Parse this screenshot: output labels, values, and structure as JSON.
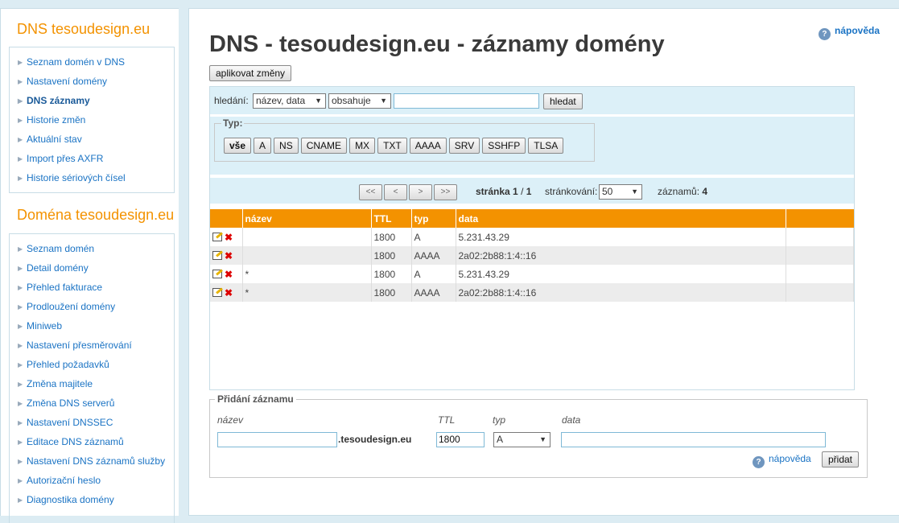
{
  "sidebar": {
    "dns_title": "DNS tesoudesign.eu",
    "dns_items": [
      {
        "label": "Seznam domén v DNS",
        "active": false
      },
      {
        "label": "Nastavení domény",
        "active": false
      },
      {
        "label": "DNS záznamy",
        "active": true
      },
      {
        "label": "Historie změn",
        "active": false
      },
      {
        "label": "Aktuální stav",
        "active": false
      },
      {
        "label": "Import přes AXFR",
        "active": false
      },
      {
        "label": "Historie sériových čísel",
        "active": false
      }
    ],
    "domain_title": "Doména tesoudesign.eu",
    "domain_items": [
      {
        "label": "Seznam domén"
      },
      {
        "label": "Detail domény"
      },
      {
        "label": "Přehled fakturace"
      },
      {
        "label": "Prodloužení domény"
      },
      {
        "label": "Miniweb"
      },
      {
        "label": "Nastavení přesměrování"
      },
      {
        "label": "Přehled požadavků"
      },
      {
        "label": "Změna majitele"
      },
      {
        "label": "Změna DNS serverů"
      },
      {
        "label": "Nastavení DNSSEC"
      },
      {
        "label": "Editace DNS záznamů"
      },
      {
        "label": "Nastavení DNS záznamů služby"
      },
      {
        "label": "Autorizační heslo"
      },
      {
        "label": "Diagnostika domény"
      }
    ]
  },
  "header": {
    "title": "DNS - tesoudesign.eu - záznamy domény",
    "help_label": "nápověda",
    "apply_label": "aplikovat změny"
  },
  "search": {
    "label": "hledání:",
    "field_value": "název, data",
    "operator_value": "obsahuje",
    "query": "",
    "button_label": "hledat"
  },
  "type_filter": {
    "legend": "Typ:",
    "buttons": [
      "vše",
      "A",
      "NS",
      "CNAME",
      "MX",
      "TXT",
      "AAAA",
      "SRV",
      "SSHFP",
      "TLSA"
    ],
    "active_index": 0
  },
  "pager": {
    "first": "<<",
    "prev": "<",
    "next": ">",
    "last": ">>",
    "page_label": "stránka",
    "page_current": "1",
    "page_total": "1",
    "pagination_label": "stránkování:",
    "page_size": "50",
    "count_label": "záznamů:",
    "count": "4"
  },
  "table": {
    "columns": [
      "název",
      "TTL",
      "typ",
      "data"
    ],
    "rows": [
      {
        "name": "",
        "ttl": "1800",
        "type": "A",
        "data": "5.231.43.29"
      },
      {
        "name": "",
        "ttl": "1800",
        "type": "AAAA",
        "data": "2a02:2b88:1:4::16"
      },
      {
        "name": "*",
        "ttl": "1800",
        "type": "A",
        "data": "5.231.43.29"
      },
      {
        "name": "*",
        "ttl": "1800",
        "type": "AAAA",
        "data": "2a02:2b88:1:4::16"
      }
    ]
  },
  "add_record": {
    "legend": "Přidání záznamu",
    "name_label": "název",
    "ttl_label": "TTL",
    "type_label": "typ",
    "data_label": "data",
    "name_value": "",
    "domain_suffix": ".tesoudesign.eu",
    "ttl_value": "1800",
    "type_value": "A",
    "data_value": "",
    "help_label": "nápověda",
    "add_label": "přidat"
  },
  "icons": {
    "edit": "edit-icon",
    "delete": "delete-icon",
    "help": "help-icon"
  },
  "colors": {
    "accent": "#f39200",
    "link": "#1a73c4",
    "panel": "#dcf0f8",
    "page_bg": "#dcecf3"
  }
}
